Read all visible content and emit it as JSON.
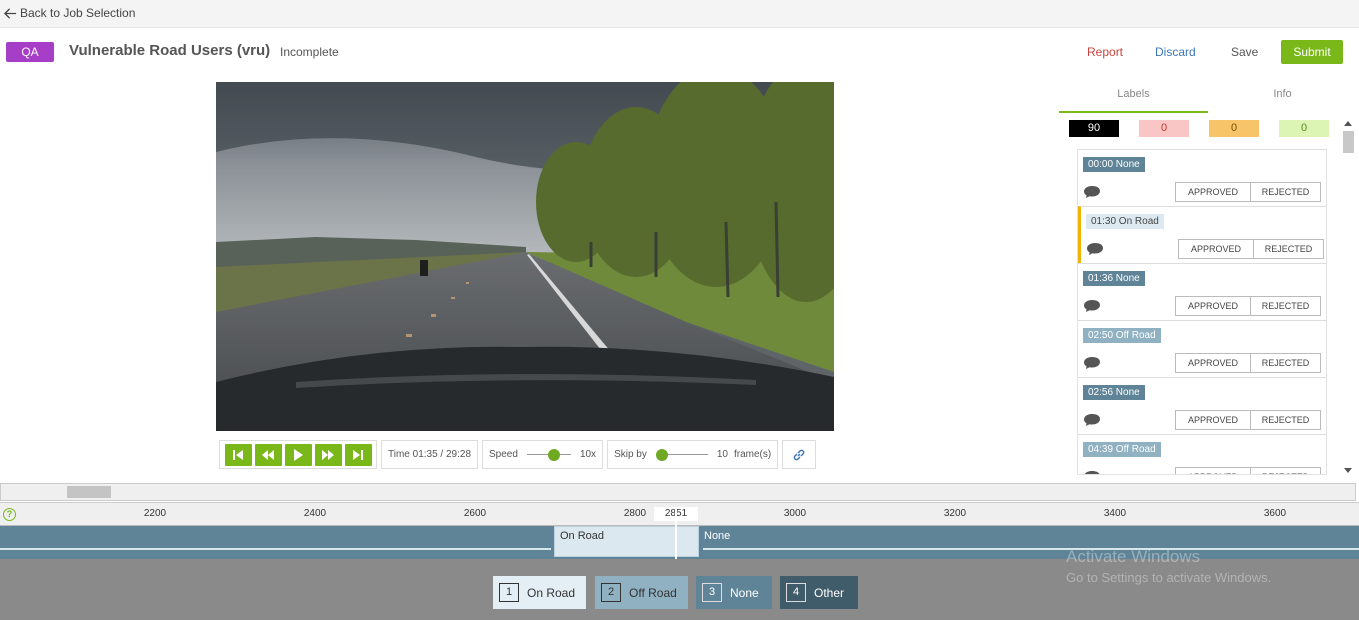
{
  "nav": {
    "back_label": "Back to Job Selection"
  },
  "header": {
    "badge": "QA",
    "title": "Vulnerable Road Users (vru)",
    "status": "Incomplete",
    "actions": {
      "report": "Report",
      "discard": "Discard",
      "save": "Save",
      "submit": "Submit"
    }
  },
  "player": {
    "time_label": "Time 01:35 / 29:28",
    "speed_label": "Speed",
    "speed_value": "10x",
    "speed_level": 0.65,
    "skip_label": "Skip by",
    "skip_value": "10",
    "skip_unit": "frame(s)",
    "skip_level": 0.0
  },
  "sidebar": {
    "tabs": [
      "Labels",
      "Info"
    ],
    "counts": [
      {
        "value": "90",
        "bg": "#000000",
        "fg": "#ffffff"
      },
      {
        "value": "0",
        "bg": "#f9c5c5",
        "fg": "#c0392b"
      },
      {
        "value": "0",
        "bg": "#f7c46a",
        "fg": "#7a5200"
      },
      {
        "value": "0",
        "bg": "#dcf5b5",
        "fg": "#5a8a1a"
      }
    ],
    "approve_label": "APPROVED",
    "reject_label": "REJECTED",
    "labels": [
      {
        "tag": "00:00 None"
      },
      {
        "tag": "01:30 On Road"
      },
      {
        "tag": "01:36 None"
      },
      {
        "tag": "02:50 Off Road"
      },
      {
        "tag": "02:56 None"
      },
      {
        "tag": "04:39 Off Road"
      }
    ]
  },
  "timeline": {
    "ticks": [
      "2200",
      "2400",
      "2600",
      "2800",
      "3000",
      "3200",
      "3400",
      "3600"
    ],
    "cursor_value": "2851",
    "help": "?",
    "segment_current": "On Road",
    "segment_next": "None"
  },
  "label_options": [
    {
      "key": "1",
      "name": "On Road"
    },
    {
      "key": "2",
      "name": "Off Road"
    },
    {
      "key": "3",
      "name": "None"
    },
    {
      "key": "4",
      "name": "Other"
    }
  ],
  "watermark": {
    "line1": "Activate Windows",
    "line2": "Go to Settings to activate Windows."
  },
  "colors": {
    "accent": "#7ab81a",
    "qa_badge": "#a73ec7",
    "track": "#5f8497"
  }
}
